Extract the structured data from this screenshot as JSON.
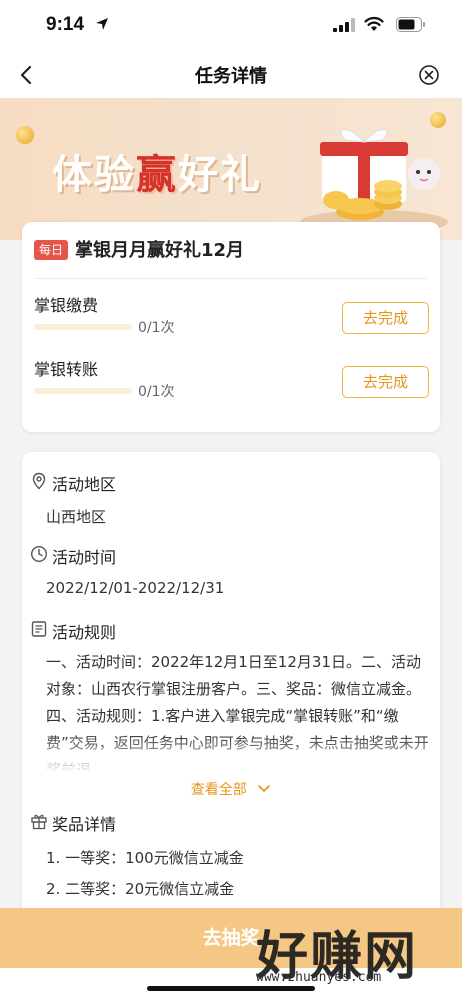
{
  "status_bar": {
    "time": "9:14"
  },
  "nav": {
    "title": "任务详情"
  },
  "banner": {
    "title_pre": "体验",
    "title_highlight": "赢",
    "title_post": "好礼"
  },
  "task_card": {
    "badge": "每日",
    "title": "掌银月月赢好礼12月",
    "items": [
      {
        "name": "掌银缴费",
        "progress_text": "0/1次",
        "progress_fraction": 0,
        "button": "去完成"
      },
      {
        "name": "掌银转账",
        "progress_text": "0/1次",
        "progress_fraction": 0,
        "button": "去完成"
      }
    ]
  },
  "info": {
    "region_label": "活动地区",
    "region_value": "山西地区",
    "time_label": "活动时间",
    "time_value": "2022/12/01-2022/12/31",
    "rules_label": "活动规则",
    "rules_text": "一、活动时间：2022年12月1日至12月31日。二、活动对象：山西农行掌银注册客户。三、奖品：微信立减金。四、活动规则：1.客户进入掌银完成“掌银转账”和“缴费”交易，返回任务中心即可参与抽奖，未点击抽奖或未开奖前退",
    "see_all": "查看全部",
    "prize_label": "奖品详情",
    "prizes": [
      "1. 一等奖：100元微信立减金",
      "2. 二等奖：20元微信立减金"
    ]
  },
  "bottom": {
    "draw_button": "去抽奖"
  },
  "watermark": {
    "text": "好赚网",
    "url": "www.zhuanyes.com"
  },
  "colors": {
    "accent": "#e79418",
    "badge_red": "#e6544b",
    "progress": "#f2b23d"
  }
}
